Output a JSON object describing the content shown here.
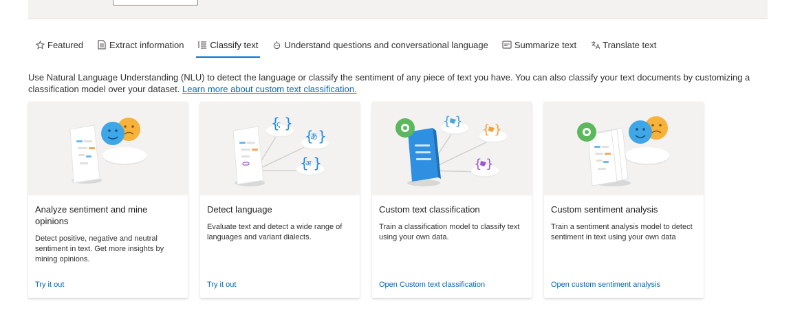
{
  "tabs": [
    {
      "label": "Featured",
      "icon": "star-icon"
    },
    {
      "label": "Extract information",
      "icon": "document-icon"
    },
    {
      "label": "Classify text",
      "icon": "list-icon"
    },
    {
      "label": "Understand questions and conversational language",
      "icon": "chat-bot-icon"
    },
    {
      "label": "Summarize text",
      "icon": "summary-icon"
    },
    {
      "label": "Translate text",
      "icon": "translate-icon"
    }
  ],
  "active_tab": "Classify text",
  "description": {
    "text": "Use Natural Language Understanding (NLU) to detect the language or classify the sentiment of any piece of text you have. You can also classify your text documents by customizing a classification model over your dataset. ",
    "link": "Learn more about custom text classification."
  },
  "cards": [
    {
      "title": "Analyze sentiment and mine opinions",
      "text": "Detect positive, negative and neutral sentiment in text. Get more insights by mining opinions.",
      "link": "Try it out"
    },
    {
      "title": "Detect language",
      "text": "Evaluate text and detect a wide range of languages and variant dialects.",
      "link": "Try it out"
    },
    {
      "title": "Custom text classification",
      "text": "Train a classification model to classify text using your own data.",
      "link": "Open Custom text classification"
    },
    {
      "title": "Custom sentiment analysis",
      "text": "Train a sentiment analysis model to detect sentiment in text using your own data",
      "link": "Open custom sentiment analysis"
    }
  ],
  "colors": {
    "accent": "#0078d4",
    "link": "#0067b8",
    "art_bg": "#f3f2f1"
  }
}
